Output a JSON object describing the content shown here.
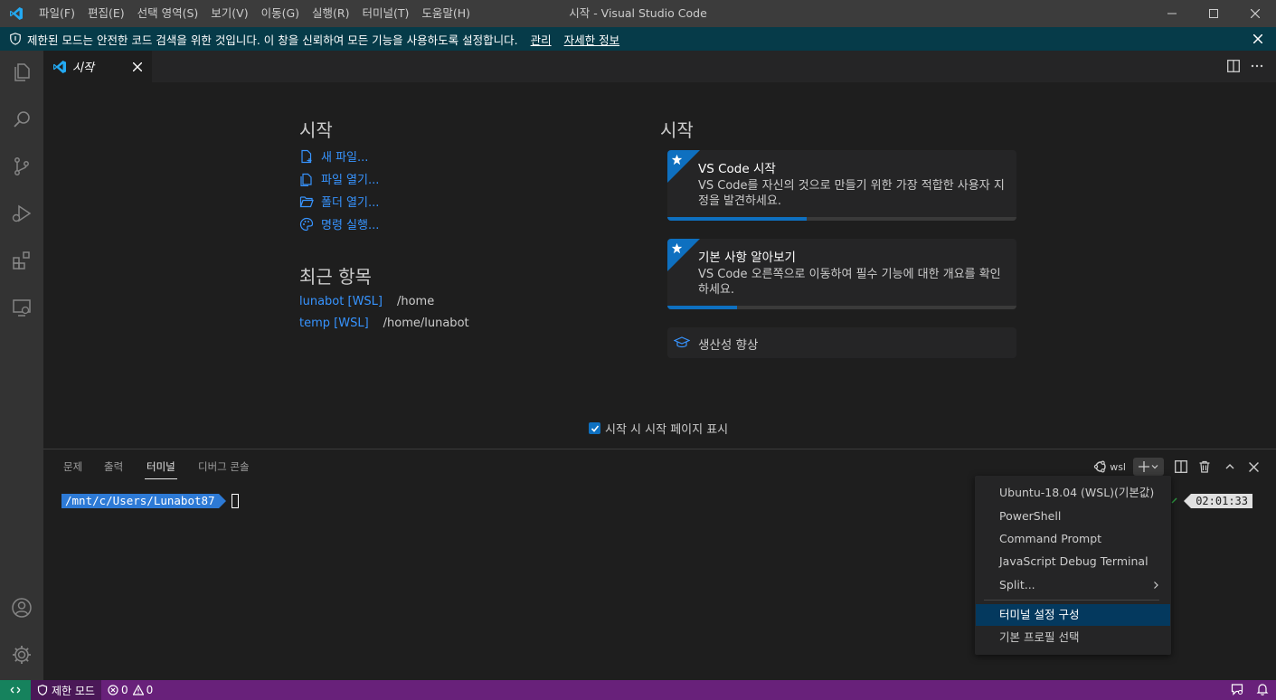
{
  "titlebar": {
    "title": "시작 - Visual Studio Code",
    "menu": [
      "파일(F)",
      "편집(E)",
      "선택 영역(S)",
      "보기(V)",
      "이동(G)",
      "실행(R)",
      "터미널(T)",
      "도움말(H)"
    ]
  },
  "banner": {
    "message": "제한된 모드는 안전한 코드 검색을 위한 것입니다. 이 창을 신뢰하여 모든 기능을 사용하도록 설정합니다.",
    "manage_link": "관리",
    "more_info_link": "자세한 정보"
  },
  "editor": {
    "tab_label": "시작"
  },
  "welcome": {
    "start_heading": "시작",
    "start_items": [
      "새 파일...",
      "파일 열기...",
      "폴더 열기...",
      "명령 실행..."
    ],
    "recent_heading": "최근 항목",
    "recent": [
      {
        "name": "lunabot [WSL]",
        "path": "/home"
      },
      {
        "name": "temp [WSL]",
        "path": "/home/lunabot"
      }
    ],
    "walkthrough_heading": "시작",
    "walkthroughs": [
      {
        "title": "VS Code 시작",
        "desc": "VS Code를 자신의 것으로 만들기 위한 가장 적합한 사용자 지정을 발견하세요.",
        "progress": 0.4
      },
      {
        "title": "기본 사항 알아보기",
        "desc": "VS Code 오른쪽으로 이동하여 필수 기능에 대한 개요를 확인하세요.",
        "progress": 0.2
      }
    ],
    "productivity_label": "생산성 향상",
    "show_on_startup_label": "시작 시 시작 페이지 표시",
    "show_on_startup_checked": true
  },
  "panel": {
    "tabs": [
      "문제",
      "출력",
      "터미널",
      "디버그 콘솔"
    ],
    "active_tab": "터미널",
    "terminal_profile_label": "wsl",
    "prompt_path": "/mnt/c/Users/Lunabot87",
    "clock": "02:01:33"
  },
  "dropdown": {
    "items": [
      "Ubuntu-18.04 (WSL)(기본값)",
      "PowerShell",
      "Command Prompt",
      "JavaScript Debug Terminal",
      "Split..."
    ],
    "config_items": [
      "터미널 설정 구성",
      "기본 프로필 선택"
    ],
    "selected": "터미널 설정 구성"
  },
  "statusbar": {
    "restricted_label": "제한 모드",
    "errors": "0",
    "warnings": "0"
  },
  "colors": {
    "accent": "#0e70c0",
    "link": "#3794ff",
    "statusbar": "#68217a",
    "banner": "#063b49"
  }
}
